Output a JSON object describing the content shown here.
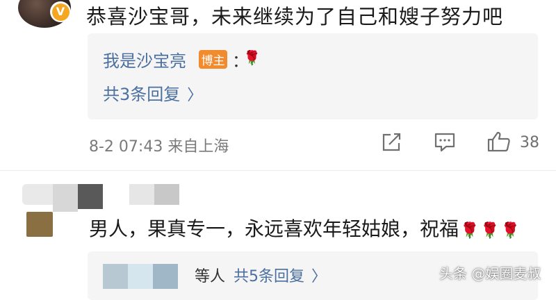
{
  "comment_1": {
    "text": "恭喜沙宝哥，未来继续为了自己和嫂子努力吧",
    "verified_badge": "V",
    "reply": {
      "author": "我是沙宝亮",
      "badge": "博主",
      "colon": "：",
      "emoji": "🌹",
      "count_label": "共3条回复"
    },
    "meta": "8-2 07:43 来自上海",
    "like_count": "38"
  },
  "comment_2": {
    "text": "男人，果真专一，永远喜欢年轻姑娘，祝福",
    "emojis": [
      "🌹",
      "🌹",
      "🌹"
    ],
    "reply": {
      "others_label": "等人",
      "count_label": "共5条回复"
    }
  },
  "watermark": "头条 @娱圈麦叔",
  "icons": [
    "verified-icon",
    "share-icon",
    "comment-icon",
    "like-icon",
    "chevron-right-icon",
    "rose-icon"
  ],
  "colors": {
    "link": "#4a6fa0",
    "host_badge": "#f28b2e",
    "verified": "#f5a623",
    "reply_bg": "#f5f5f5"
  }
}
